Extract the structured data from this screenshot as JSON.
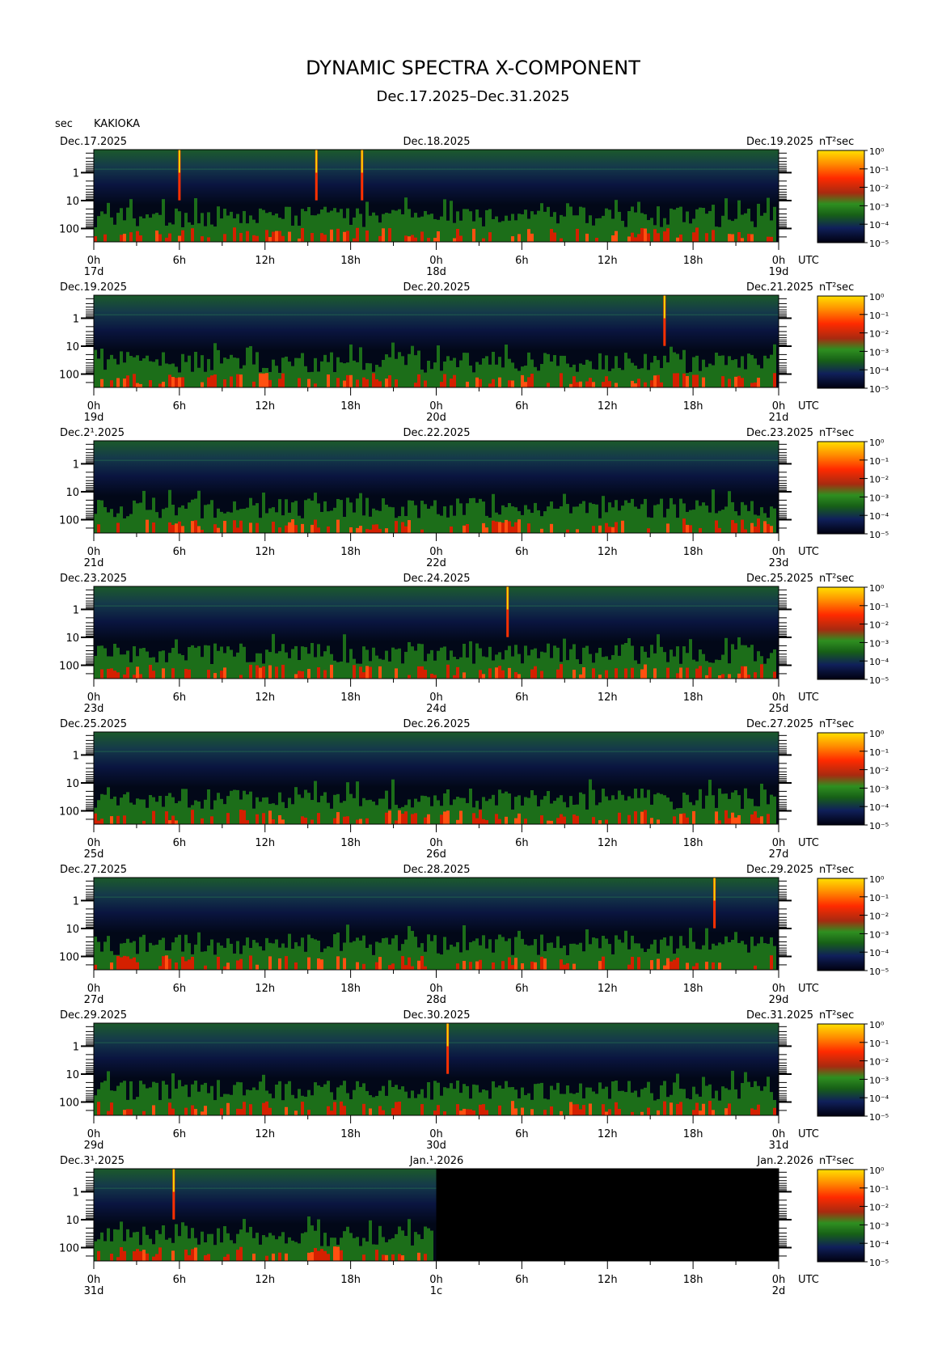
{
  "title": "DYNAMIC SPECTRA X-COMPONENT",
  "subtitle": "Dec.17.2025–Dec.31.2025",
  "station": "KAKIOKA",
  "y_unit": "sec",
  "colorbar_unit": "nT²sec",
  "utc_label": "UTC",
  "chart_data": {
    "type": "heatmap",
    "x_axis": "hours (UTC) across two days per panel",
    "y_axis": "period (sec), logarithmic",
    "y_ticks": [
      "1",
      "10",
      "100"
    ],
    "x_ticks": [
      "0h",
      "6h",
      "12h",
      "18h",
      "0h",
      "6h",
      "12h",
      "18h",
      "0h"
    ],
    "colorbar_ticks": [
      "10⁰",
      "10⁻¹",
      "10⁻²",
      "10⁻³",
      "10⁻⁴",
      "10⁻⁵"
    ],
    "colorscale": [
      "#000010",
      "#10205a",
      "#1a6a1a",
      "#2f8f20",
      "#c03010",
      "#ff2000",
      "#ff8000",
      "#ffe000"
    ],
    "panels": [
      {
        "left_date": "Dec.17.2025",
        "mid_date": "Dec.18.2025",
        "right_date": "Dec.19.2025",
        "day_labels": [
          "17d",
          "18d",
          "19d"
        ],
        "spikes_hour": [
          6.0,
          15.6,
          18.8
        ],
        "data_end_hour": 48
      },
      {
        "left_date": "Dec.19.2025",
        "mid_date": "Dec.20.2025",
        "right_date": "Dec.21.2025",
        "day_labels": [
          "19d",
          "20d",
          "21d"
        ],
        "spikes_hour": [
          40.0
        ],
        "data_end_hour": 48
      },
      {
        "left_date": "Dec.2¹.2025",
        "mid_date": "Dec.22.2025",
        "right_date": "Dec.23.2025",
        "day_labels": [
          "21d",
          "22d",
          "23d"
        ],
        "spikes_hour": [],
        "data_end_hour": 48
      },
      {
        "left_date": "Dec.23.2025",
        "mid_date": "Dec.24.2025",
        "right_date": "Dec.25.2025",
        "day_labels": [
          "23d",
          "24d",
          "25d"
        ],
        "spikes_hour": [
          29.0
        ],
        "data_end_hour": 48
      },
      {
        "left_date": "Dec.25.2025",
        "mid_date": "Dec.26.2025",
        "right_date": "Dec.27.2025",
        "day_labels": [
          "25d",
          "26d",
          "27d"
        ],
        "spikes_hour": [],
        "data_end_hour": 48
      },
      {
        "left_date": "Dec.27.2025",
        "mid_date": "Dec.28.2025",
        "right_date": "Dec.29.2025",
        "day_labels": [
          "27d",
          "28d",
          "29d"
        ],
        "spikes_hour": [
          43.5
        ],
        "data_end_hour": 48
      },
      {
        "left_date": "Dec.29.2025",
        "mid_date": "Dec.30.2025",
        "right_date": "Dec.31.2025",
        "day_labels": [
          "29d",
          "30d",
          "31d"
        ],
        "spikes_hour": [
          24.8
        ],
        "data_end_hour": 48
      },
      {
        "left_date": "Dec.3¹.2025",
        "mid_date": "Jan.¹.2026",
        "right_date": "Jan.2.2026",
        "day_labels": [
          "31d",
          "1c",
          "2d"
        ],
        "spikes_hour": [
          5.6
        ],
        "data_end_hour": 24
      }
    ]
  }
}
